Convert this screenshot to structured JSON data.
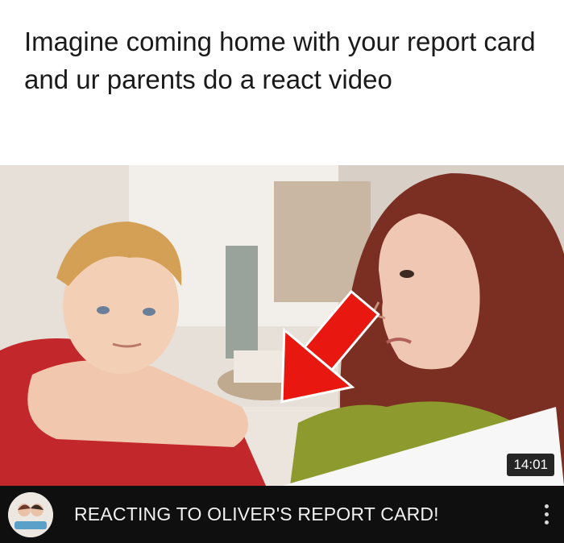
{
  "caption": "Imagine coming home with your report card and ur parents do a react video",
  "video": {
    "duration": "14:01",
    "title": "REACTING TO OLIVER'S REPORT CARD!",
    "thumbnail_icon": "boy-and-woman-thumbnail",
    "arrow_color": "#e8170f"
  },
  "channel": {
    "avatar_icon": "channel-avatar-icon"
  },
  "menu_icon": "more-vert-icon"
}
